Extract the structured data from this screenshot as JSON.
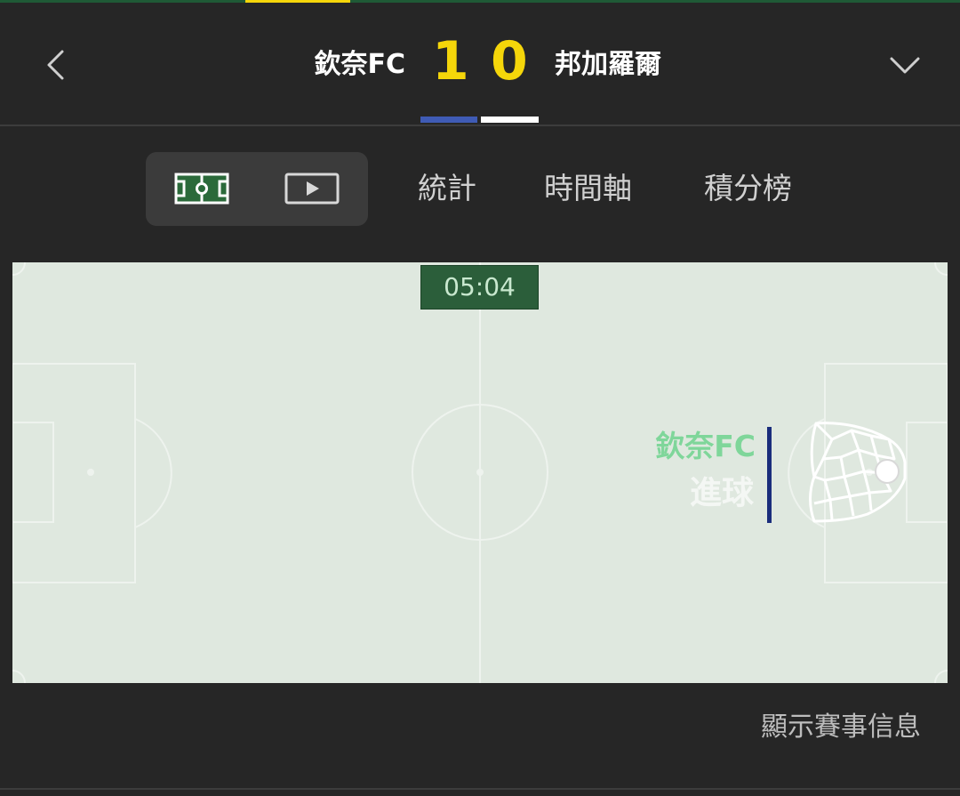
{
  "match": {
    "home_team": "欽奈FC",
    "away_team": "邦加羅爾",
    "home_score": "1",
    "away_score": "0",
    "home_color": "#3f5bb5",
    "away_color": "#ffffff",
    "score_color": "#f5d60a"
  },
  "nav": {
    "back_icon": "chevron-left-icon",
    "collapse_icon": "chevron-down-icon"
  },
  "tabs": {
    "view_modes": [
      {
        "icon": "pitch-icon",
        "selected": true
      },
      {
        "icon": "video-play-icon",
        "selected": false
      }
    ],
    "items": [
      {
        "label": "統計"
      },
      {
        "label": "時間軸"
      },
      {
        "label": "積分榜"
      }
    ]
  },
  "pitch": {
    "clock": "05:04",
    "event": {
      "team": "欽奈FC",
      "type": "進球",
      "icon": "goal-net-icon",
      "accent_color": "#1a2d7c",
      "team_color": "#7fd69a"
    }
  },
  "footer": {
    "show_info_label": "顯示賽事信息"
  }
}
